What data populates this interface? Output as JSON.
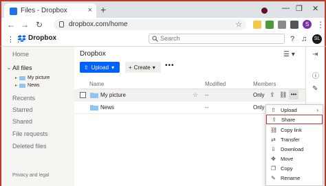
{
  "browser": {
    "tab_title": "Files - Dropbox",
    "tab_close": "×",
    "new_tab": "+",
    "url": "dropbox.com/home",
    "window_controls": [
      "⌄",
      "—",
      "❐",
      "✕"
    ],
    "profile_initial": "S"
  },
  "header": {
    "brand": "Dropbox",
    "search_placeholder": "Search",
    "avatar_initials": "SL"
  },
  "sidebar": {
    "items": [
      {
        "label": "Home"
      },
      {
        "label": "All files"
      },
      {
        "label": "Recents"
      },
      {
        "label": "Starred"
      },
      {
        "label": "Shared"
      },
      {
        "label": "File requests"
      },
      {
        "label": "Deleted files"
      }
    ],
    "tree": [
      {
        "label": "My picture"
      },
      {
        "label": "News"
      }
    ],
    "footer": "Privacy and legal"
  },
  "main": {
    "title": "Dropbox",
    "upload_label": "Upload",
    "create_label": "Create",
    "more_label": "•••",
    "columns": {
      "name": "Name",
      "modified": "Modified",
      "members": "Members"
    },
    "rows": [
      {
        "name": "My picture",
        "modified": "--",
        "members": "Only"
      },
      {
        "name": "News",
        "modified": "--",
        "members": "Only yo"
      }
    ]
  },
  "context_menu": {
    "items": [
      {
        "label": "Upload",
        "icon": "upload-icon"
      },
      {
        "label": "Share",
        "icon": "share-icon"
      },
      {
        "label": "Copy link",
        "icon": "link-icon"
      },
      {
        "label": "Transfer",
        "icon": "transfer-icon"
      },
      {
        "label": "Download",
        "icon": "download-icon"
      },
      {
        "label": "Move",
        "icon": "move-icon"
      },
      {
        "label": "Copy",
        "icon": "copy-icon"
      },
      {
        "label": "Rename",
        "icon": "rename-icon"
      }
    ]
  },
  "colors": {
    "accent": "#0061fe",
    "highlight_border": "#d0312d",
    "folder": "#8ec5f5"
  }
}
